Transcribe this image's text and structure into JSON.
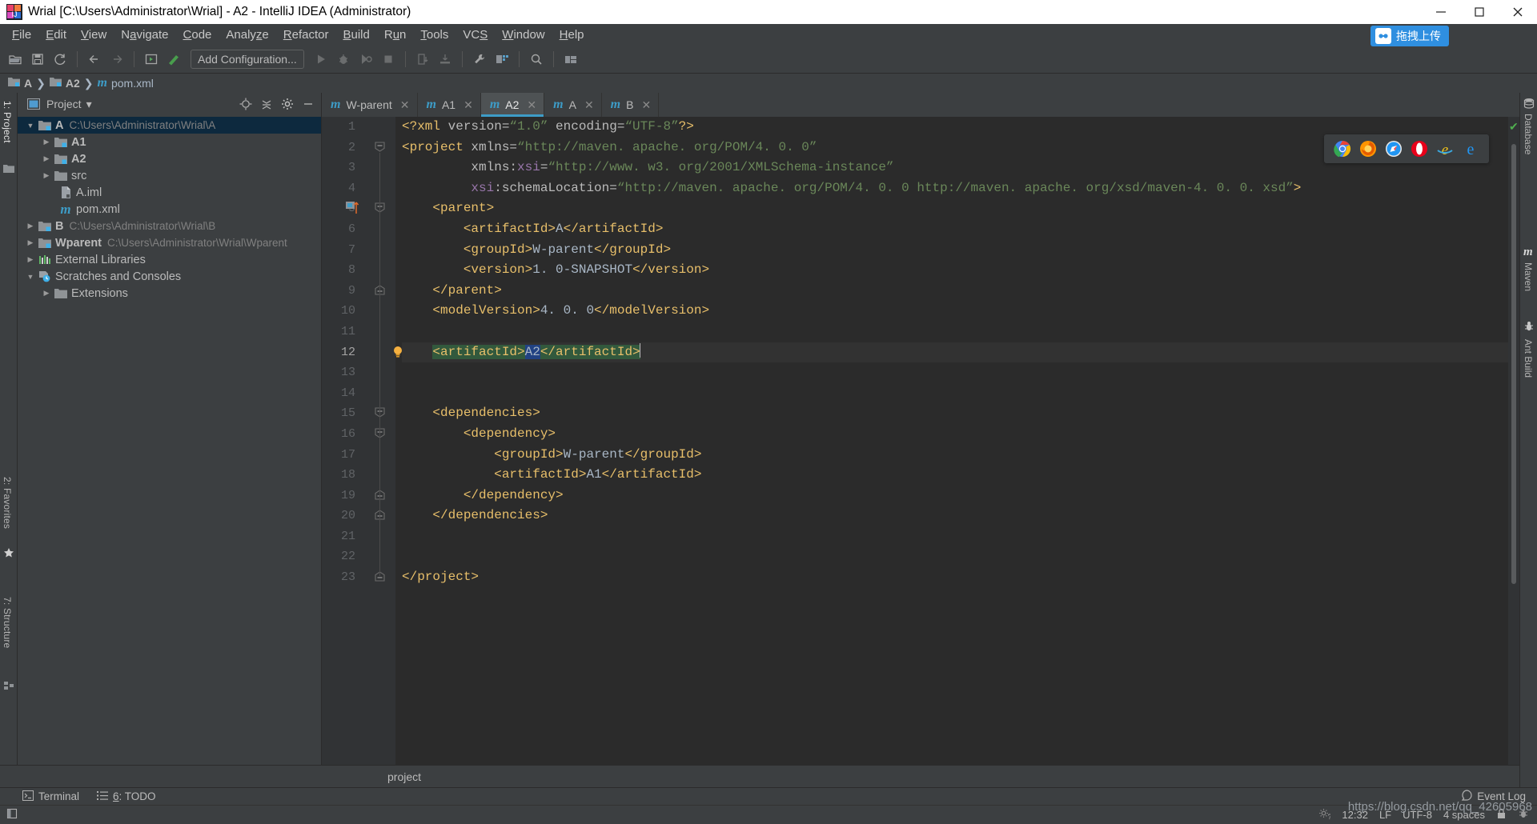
{
  "window": {
    "title": "Wrial [C:\\Users\\Administrator\\Wrial] - A2 - IntelliJ IDEA (Administrator)",
    "minimize": "–",
    "maximize": "❐",
    "close": "✕"
  },
  "menu": {
    "items": [
      "File",
      "Edit",
      "View",
      "Navigate",
      "Code",
      "Analyze",
      "Refactor",
      "Build",
      "Run",
      "Tools",
      "VCS",
      "Window",
      "Help"
    ],
    "upload_badge": "拖拽上传"
  },
  "toolbar": {
    "add_configuration": "Add Configuration...",
    "icons": [
      "open-folder-icon",
      "save-icon",
      "sync-icon",
      "back-arrow-icon",
      "forward-arrow-icon",
      "run-config-icon",
      "build-icon",
      "run-icon",
      "debug-icon",
      "coverage-icon",
      "stop-icon",
      "update-project-icon",
      "commit-icon",
      "settings-wrench-icon",
      "project-structure-icon",
      "search-icon",
      "layout-icon"
    ]
  },
  "breadcrumb": {
    "items": [
      {
        "label": "A",
        "icon": "module-folder-icon",
        "bold": true
      },
      {
        "label": "A2",
        "icon": "module-folder-icon",
        "bold": true
      },
      {
        "label": "pom.xml",
        "icon": "maven-m-icon",
        "bold": false
      }
    ],
    "separator": "❯"
  },
  "left_strip": {
    "tabs": [
      {
        "label": "1: Project",
        "selected": true
      },
      {
        "label": "2: Favorites",
        "selected": false
      },
      {
        "label": "7: Structure",
        "selected": false
      }
    ]
  },
  "right_strip": {
    "tabs": [
      {
        "label": "Database",
        "icon": "database-icon"
      },
      {
        "label": "Maven",
        "icon": "maven-m-icon"
      },
      {
        "label": "Ant Build",
        "icon": "ant-icon"
      }
    ]
  },
  "project_panel": {
    "title": "Project",
    "dropdown": "▾",
    "actions": [
      "locate-target-icon",
      "collapse-all-icon",
      "settings-gear-icon",
      "hide-panel-icon"
    ],
    "tree": [
      {
        "indent": 0,
        "arrow": "▼",
        "icon": "module-folder-icon",
        "label": "A",
        "bold": true,
        "path": "C:\\Users\\Administrator\\Wrial\\A",
        "selected": true
      },
      {
        "indent": 1,
        "arrow": "▶",
        "icon": "module-folder-icon",
        "label": "A1",
        "bold": true,
        "path": "",
        "selected": false
      },
      {
        "indent": 1,
        "arrow": "▶",
        "icon": "module-folder-icon",
        "label": "A2",
        "bold": true,
        "path": "",
        "selected": false
      },
      {
        "indent": 1,
        "arrow": "▶",
        "icon": "folder-icon",
        "label": "src",
        "bold": false,
        "path": "",
        "selected": false
      },
      {
        "indent": 2,
        "arrow": "",
        "icon": "iml-file-icon",
        "label": "A.iml",
        "bold": false,
        "path": "",
        "selected": false
      },
      {
        "indent": 2,
        "arrow": "",
        "icon": "maven-m-icon",
        "label": "pom.xml",
        "bold": false,
        "path": "",
        "selected": false
      },
      {
        "indent": 0,
        "arrow": "▶",
        "icon": "module-folder-icon",
        "label": "B",
        "bold": true,
        "path": "C:\\Users\\Administrator\\Wrial\\B",
        "selected": false
      },
      {
        "indent": 0,
        "arrow": "▶",
        "icon": "module-folder-icon",
        "label": "Wparent",
        "bold": true,
        "path": "C:\\Users\\Administrator\\Wrial\\Wparent",
        "selected": false
      },
      {
        "indent": 0,
        "arrow": "▶",
        "icon": "external-libraries-icon",
        "label": "External Libraries",
        "bold": false,
        "path": "",
        "selected": false
      },
      {
        "indent": 0,
        "arrow": "▼",
        "icon": "scratches-icon",
        "label": "Scratches and Consoles",
        "bold": false,
        "path": "",
        "selected": false
      },
      {
        "indent": 1,
        "arrow": "▶",
        "icon": "folder-icon",
        "label": "Extensions",
        "bold": false,
        "path": "",
        "selected": false
      }
    ]
  },
  "editor": {
    "tabs": [
      {
        "label": "W-parent",
        "icon": "maven-m-icon",
        "active": false,
        "close": "✕"
      },
      {
        "label": "A1",
        "icon": "maven-m-icon",
        "active": false,
        "close": "✕"
      },
      {
        "label": "A2",
        "icon": "maven-m-icon",
        "active": true,
        "close": "✕"
      },
      {
        "label": "A",
        "icon": "maven-m-icon",
        "active": false,
        "close": "✕"
      },
      {
        "label": "B",
        "icon": "maven-m-icon",
        "active": false,
        "close": "✕"
      }
    ],
    "line_numbers": [
      1,
      2,
      3,
      4,
      5,
      6,
      7,
      8,
      9,
      10,
      11,
      12,
      13,
      14,
      15,
      16,
      17,
      18,
      19,
      20,
      21,
      22,
      23
    ],
    "current_line": 12,
    "lines": [
      {
        "n": 1,
        "fold": "",
        "marker": "",
        "bulb": false,
        "html": "<span class=\"tag\">&lt;?xml </span><span class=\"attr\">version=</span><span class=\"str\">“1.0”</span><span class=\"attr\"> encoding=</span><span class=\"str\">“UTF-8”</span><span class=\"tag\">?&gt;</span>"
      },
      {
        "n": 2,
        "fold": "minus",
        "marker": "",
        "bulb": false,
        "html": "<span class=\"tag\">&lt;project </span><span class=\"attr\">xmlns=</span><span class=\"str\">“http://maven. apache. org/POM/4. 0. 0”</span>"
      },
      {
        "n": 3,
        "fold": "",
        "marker": "",
        "bulb": false,
        "html": "         <span class=\"attr\">xmlns:</span><span class=\"aname\">xsi</span><span class=\"attr\">=</span><span class=\"str\">“http://www. w3. org/2001/XMLSchema-instance”</span>"
      },
      {
        "n": 4,
        "fold": "",
        "marker": "",
        "bulb": false,
        "html": "         <span class=\"aname\">xsi</span><span class=\"attr\">:schemaLocation=</span><span class=\"str\">“http://maven. apache. org/POM/4. 0. 0 http://maven. apache. org/xsd/maven-4. 0. 0. xsd”</span><span class=\"tag\">&gt;</span>"
      },
      {
        "n": 5,
        "fold": "minus",
        "marker": "maven-m-icon",
        "bulb": false,
        "html": "    <span class=\"tag\">&lt;parent&gt;</span>"
      },
      {
        "n": 6,
        "fold": "",
        "marker": "",
        "bulb": false,
        "html": "        <span class=\"tag\">&lt;artifactId&gt;</span><span class=\"txt\">A</span><span class=\"tag\">&lt;/artifactId&gt;</span>"
      },
      {
        "n": 7,
        "fold": "",
        "marker": "",
        "bulb": false,
        "html": "        <span class=\"tag\">&lt;groupId&gt;</span><span class=\"txt\">W-parent</span><span class=\"tag\">&lt;/groupId&gt;</span>"
      },
      {
        "n": 8,
        "fold": "",
        "marker": "",
        "bulb": false,
        "html": "        <span class=\"tag\">&lt;version&gt;</span><span class=\"txt\">1. 0-SNAPSHOT</span><span class=\"tag\">&lt;/version&gt;</span>"
      },
      {
        "n": 9,
        "fold": "end",
        "marker": "",
        "bulb": false,
        "html": "    <span class=\"tag\">&lt;/parent&gt;</span>"
      },
      {
        "n": 10,
        "fold": "",
        "marker": "",
        "bulb": false,
        "html": "    <span class=\"tag\">&lt;modelVersion&gt;</span><span class=\"txt\">4. 0. 0</span><span class=\"tag\">&lt;/modelVersion&gt;</span>"
      },
      {
        "n": 11,
        "fold": "",
        "marker": "",
        "bulb": false,
        "html": ""
      },
      {
        "n": 12,
        "fold": "",
        "marker": "",
        "bulb": true,
        "html": "    <span class=\"greenhl tag\">&lt;artifactId&gt;</span><span class=\"selhl txt\">A2</span><span class=\"greenhl tag\">&lt;/artifactId&gt;</span><span class=\"caret\"></span>"
      },
      {
        "n": 13,
        "fold": "",
        "marker": "",
        "bulb": false,
        "html": ""
      },
      {
        "n": 14,
        "fold": "",
        "marker": "",
        "bulb": false,
        "html": ""
      },
      {
        "n": 15,
        "fold": "minus",
        "marker": "",
        "bulb": false,
        "html": "    <span class=\"tag\">&lt;dependencies&gt;</span>"
      },
      {
        "n": 16,
        "fold": "minus",
        "marker": "",
        "bulb": false,
        "html": "        <span class=\"tag\">&lt;dependency&gt;</span>"
      },
      {
        "n": 17,
        "fold": "",
        "marker": "",
        "bulb": false,
        "html": "            <span class=\"tag\">&lt;groupId&gt;</span><span class=\"txt\">W-parent</span><span class=\"tag\">&lt;/groupId&gt;</span>"
      },
      {
        "n": 18,
        "fold": "",
        "marker": "",
        "bulb": false,
        "html": "            <span class=\"tag\">&lt;artifactId&gt;</span><span class=\"txt\">A1</span><span class=\"tag\">&lt;/artifactId&gt;</span>"
      },
      {
        "n": 19,
        "fold": "end",
        "marker": "",
        "bulb": false,
        "html": "        <span class=\"tag\">&lt;/dependency&gt;</span>"
      },
      {
        "n": 20,
        "fold": "end",
        "marker": "",
        "bulb": false,
        "html": "    <span class=\"tag\">&lt;/dependencies&gt;</span>"
      },
      {
        "n": 21,
        "fold": "",
        "marker": "",
        "bulb": false,
        "html": ""
      },
      {
        "n": 22,
        "fold": "",
        "marker": "",
        "bulb": false,
        "html": ""
      },
      {
        "n": 23,
        "fold": "end",
        "marker": "",
        "bulb": false,
        "html": "<span class=\"tag\">&lt;/project&gt;</span>"
      }
    ],
    "breadcrumb_bottom": "project",
    "inspection_status": "ok-check-icon"
  },
  "browser_popup": {
    "icons": [
      "chrome-icon",
      "firefox-icon",
      "safari-icon",
      "opera-icon",
      "internet-explorer-icon",
      "edge-icon"
    ]
  },
  "bottom_tools": [
    {
      "label": "Terminal",
      "icon": "terminal-icon",
      "underline": ""
    },
    {
      "label": ": TODO",
      "icon": "todo-icon",
      "underline": "6"
    }
  ],
  "status_bar": {
    "left_icon": "show-tool-windows-icon",
    "time": "12:32",
    "line_separator": "LF",
    "encoding": "UTF-8",
    "indent": "4 spaces",
    "event_log": "Event Log",
    "watermark": "https://blog.csdn.net/qq_42605968",
    "help_icon": "help-gear-icon",
    "lock_icon": "lock-icon",
    "inspection_icon": "inspection-icon"
  },
  "colors": {
    "accent": "#3d9cc7",
    "tag": "#e8bf6a",
    "string": "#6a8759",
    "selection": "#214283",
    "green_highlight": "#32593d",
    "panel": "#3c3f41",
    "editor_bg": "#2b2b2b",
    "tree_selected": "#0d293e"
  }
}
